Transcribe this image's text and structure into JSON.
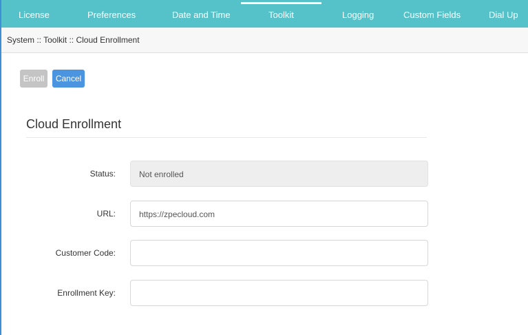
{
  "nav": {
    "tabs": [
      {
        "label": "License"
      },
      {
        "label": "Preferences"
      },
      {
        "label": "Date and Time"
      },
      {
        "label": "Toolkit",
        "active": true
      },
      {
        "label": "Logging"
      },
      {
        "label": "Custom Fields"
      },
      {
        "label": "Dial Up"
      }
    ],
    "color": "#54c2c8"
  },
  "breadcrumb": "System :: Toolkit :: Cloud Enrollment",
  "toolbar": {
    "enroll_label": "Enroll",
    "cancel_label": "Cancel"
  },
  "form": {
    "title": "Cloud Enrollment",
    "status": {
      "label": "Status:",
      "value": "Not enrolled"
    },
    "url": {
      "label": "URL:",
      "value": "https://zpecloud.com"
    },
    "customer_code": {
      "label": "Customer Code:",
      "value": ""
    },
    "enrollment_key": {
      "label": "Enrollment Key:",
      "value": ""
    }
  }
}
